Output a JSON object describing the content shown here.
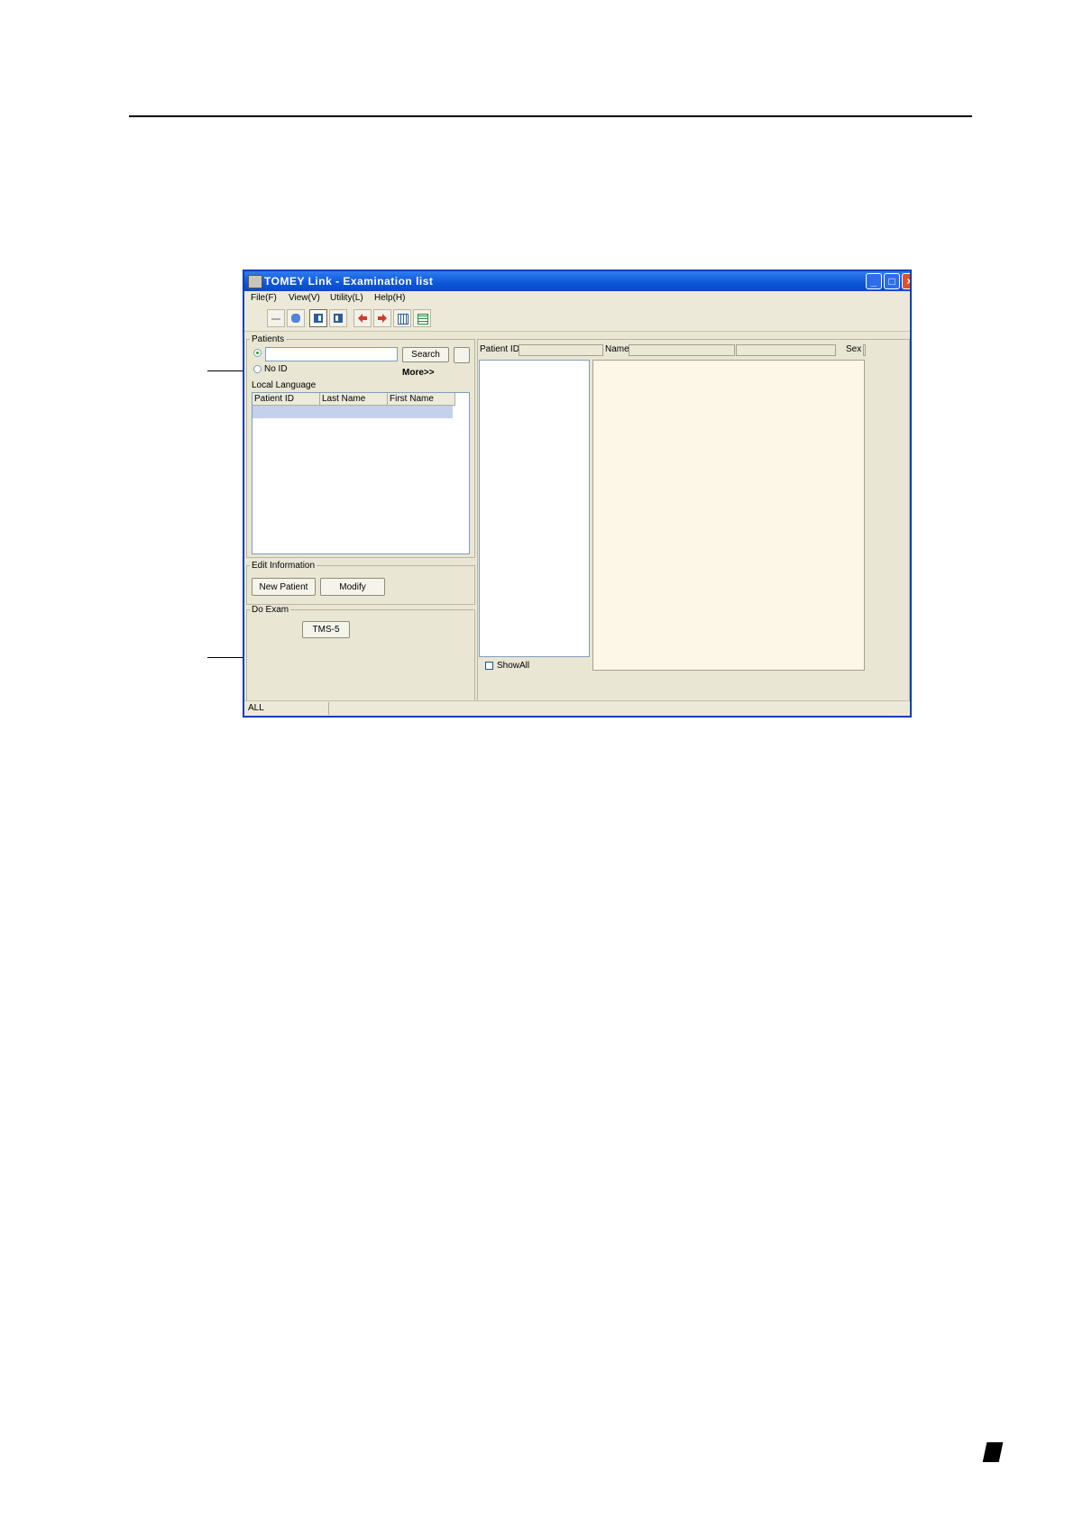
{
  "window": {
    "title": "TOMEY Link - Examination list"
  },
  "menu": [
    {
      "label": "File(F)"
    },
    {
      "label": "View(V)"
    },
    {
      "label": "Utility(L)"
    },
    {
      "label": "Help(H)"
    }
  ],
  "toolbar": {
    "icons": [
      "arrow-icon",
      "database-icon",
      "layout-left-icon",
      "layout-right-icon",
      "import-icon",
      "export-icon",
      "grid-icon",
      "list-icon"
    ]
  },
  "patients": {
    "group_label": "Patients",
    "search_value": "",
    "no_id_label": "No ID",
    "search_button": "Search",
    "more_link": "More>>",
    "local_language_label": "Local Language",
    "columns": [
      "Patient ID",
      "Last Name",
      "First Name"
    ]
  },
  "edit": {
    "group_label": "Edit Information",
    "new_patient": "New Patient",
    "modify": "Modify"
  },
  "exam": {
    "group_label": "Do Exam",
    "tms5": "TMS-5"
  },
  "detail": {
    "patient_id_label": "Patient ID",
    "name_label": "Name",
    "sex_label": "Sex",
    "show_all_label": "ShowAll"
  },
  "status": {
    "text": "ALL"
  },
  "colors": {
    "titlebar": "#0b56d8",
    "window_bg": "#e9e6d4",
    "preview_bg": "#fdf7e8"
  }
}
